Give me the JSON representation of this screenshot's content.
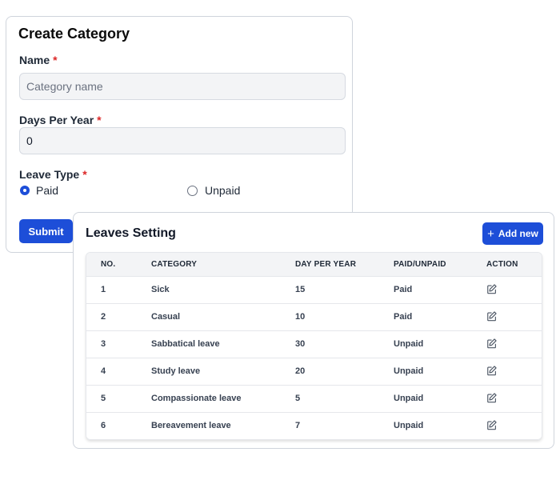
{
  "create_form": {
    "title": "Create Category",
    "name_label": "Name",
    "name_placeholder": "Category name",
    "days_label": "Days Per Year",
    "days_value": "0",
    "leave_type_label": "Leave Type",
    "required_marker": "*",
    "options": [
      {
        "label": "Paid",
        "selected": true
      },
      {
        "label": "Unpaid",
        "selected": false
      }
    ],
    "submit_label": "Submit"
  },
  "leaves_setting": {
    "title": "Leaves Setting",
    "add_label": "Add new",
    "add_icon": "plus-icon",
    "columns": [
      "NO.",
      "CATEGORY",
      "DAY PER YEAR",
      "PAID/UNPAID",
      "ACTION"
    ],
    "rows": [
      {
        "no": "1",
        "category": "Sick",
        "days": "15",
        "type": "Paid"
      },
      {
        "no": "2",
        "category": "Casual",
        "days": "10",
        "type": "Paid"
      },
      {
        "no": "3",
        "category": "Sabbatical leave",
        "days": "30",
        "type": "Unpaid"
      },
      {
        "no": "4",
        "category": "Study leave",
        "days": "20",
        "type": "Unpaid"
      },
      {
        "no": "5",
        "category": "Compassionate leave",
        "days": "5",
        "type": "Unpaid"
      },
      {
        "no": "6",
        "category": "Bereavement leave",
        "days": "7",
        "type": "Unpaid"
      }
    ],
    "action_icon": "edit-icon"
  },
  "colors": {
    "primary": "#1d4ed8",
    "required": "#dc2626",
    "input_bg": "#f3f4f6",
    "border": "#cfd4dc"
  }
}
